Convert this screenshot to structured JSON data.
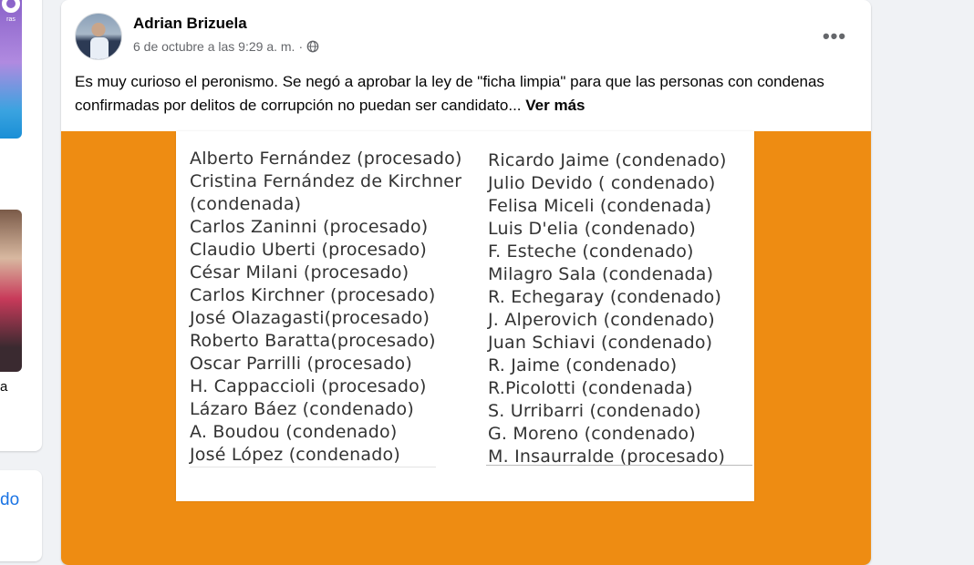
{
  "left_column": {
    "promo_text": "ras",
    "name_fragment": "a",
    "link_fragment": "do"
  },
  "post": {
    "author": "Adrian Brizuela",
    "timestamp": "6 de octubre a las 9:29 a. m.",
    "separator": "·",
    "privacy_icon": "globe-icon",
    "more_icon": "more-options-icon",
    "more_label": "•••",
    "text": "Es muy curioso el peronismo. Se negó a aprobar la ley de \"ficha limpia\" para que las personas con condenas confirmadas por delitos de corrupción no puedan ser candidato...",
    "see_more": "Ver más"
  },
  "image": {
    "background_color": "#ee8c12",
    "left_list": [
      "Alberto Fernández (procesado)",
      "Cristina Fernández de Kirchner",
      "(condenada)",
      "Carlos Zaninni (procesado)",
      "Claudio Uberti (procesado)",
      "César Milani (procesado)",
      "Carlos Kirchner (procesado)",
      "José Olazagasti(procesado)",
      "Roberto Baratta(procesado)",
      "Oscar  Parrilli (procesado)",
      "H. Cappaccioli (procesado)",
      "Lázaro Báez (condenado)",
      "A. Boudou (condenado)",
      "José López (condenado)"
    ],
    "right_list": [
      "Ricardo Jaime (condenado)",
      "Julio Devido ( condenado)",
      "Felisa Miceli (condenada)",
      "Luis D'elia (condenado)",
      "F. Esteche (condenado)",
      "Milagro Sala (condenada)",
      "R. Echegaray (condenado)",
      "J. Alperovich (condenado)",
      "Juan Schiavi (condenado)",
      "R. Jaime (condenado)",
      "R.Picolotti (condenada)",
      "S. Urribarri (condenado)",
      "G. Moreno (condenado)",
      "M. Insaurralde (procesado)"
    ]
  }
}
